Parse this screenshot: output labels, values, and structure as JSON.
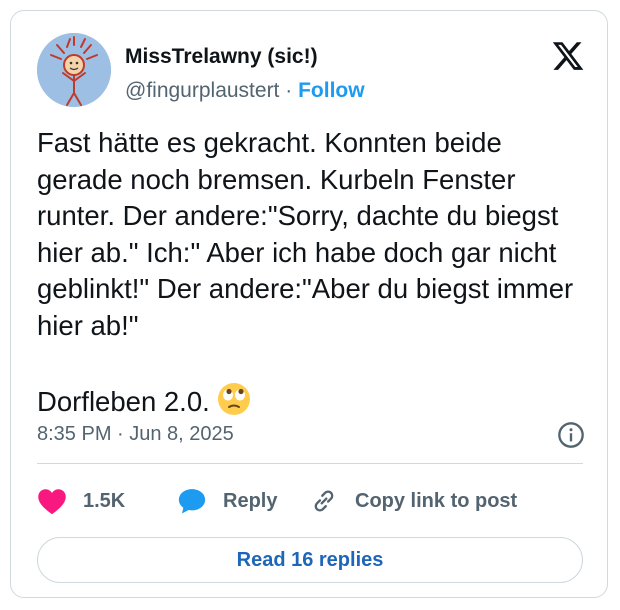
{
  "author": {
    "name": "MissTrelawny (sic!)",
    "handle": "@fingurplaustert",
    "separator": "·",
    "follow_label": "Follow"
  },
  "tweet": {
    "text": "Fast hätte es gekracht. Konnten beide gerade noch bremsen. Kurbeln Fenster runter. Der andere:\"Sorry, dachte du biegst hier ab.\" Ich:\" Aber ich habe doch gar nicht geblinkt!\" Der andere:\"Aber du biegst immer hier ab!\"\n\nDorfleben 2.0.",
    "emoji": "face-with-rolling-eyes",
    "timestamp": "8:35 PM · Jun 8, 2025"
  },
  "actions": {
    "like_count": "1.5K",
    "reply_label": "Reply",
    "copy_link_label": "Copy link to post"
  },
  "read_replies_label": "Read 16 replies",
  "icons": [
    "x-logo-icon",
    "info-icon",
    "heart-icon",
    "reply-bubble-icon",
    "link-icon"
  ],
  "colors": {
    "accent": "#1d9bf0",
    "like": "#f91880",
    "secondary_text": "#536471",
    "border": "#cfd9de"
  }
}
